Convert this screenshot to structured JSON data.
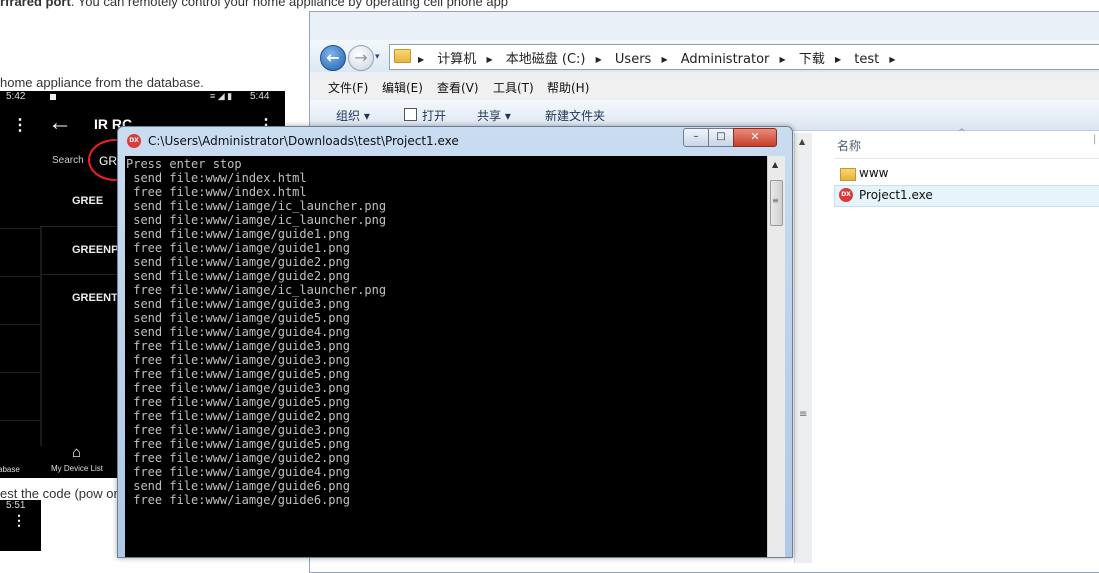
{
  "web": {
    "line1_bold": "rfrared port",
    "line1_rest": ". You can remotely control your home appliance by operating cell phone app",
    "line2": "home appliance from the database.",
    "line3": "est the code (pow on"
  },
  "phone": {
    "time_left": "5:42",
    "time_right": "5:44",
    "status_icons": "≡ ◢ ▮",
    "menu_icon": "⋮",
    "back_icon": "←",
    "title": "IR RC",
    "search_label": "Search",
    "search_value": "GR",
    "brands": [
      "GREE",
      "GREENP",
      "GREENT"
    ],
    "home_icon": "⌂",
    "device_list_label": "My Device List",
    "database_label": "abase"
  },
  "phone2": {
    "time": "5:51",
    "menu_icon": "⋮"
  },
  "explorer": {
    "breadcrumbs": [
      "计算机",
      "本地磁盘 (C:)",
      "Users",
      "Administrator",
      "下载",
      "test"
    ],
    "crumb_separator": "▶",
    "menu": [
      "文件(F)",
      "编辑(E)",
      "查看(V)",
      "工具(T)",
      "帮助(H)"
    ],
    "toolbar": {
      "organize": "组织 ▾",
      "open": "打开",
      "share": "共享 ▾",
      "new_folder": "新建文件夹"
    },
    "column_name": "名称",
    "files": [
      {
        "name": "www",
        "type": "folder"
      },
      {
        "name": "Project1.exe",
        "type": "exe",
        "selected": true
      }
    ],
    "back_icon": "←",
    "forward_icon": "→",
    "dropdown_icon": "▾"
  },
  "console": {
    "title": "C:\\Users\\Administrator\\Downloads\\test\\Project1.exe",
    "icon_text": "DX",
    "buttons": {
      "minimize": "–",
      "maximize": "□",
      "close": "✕"
    },
    "lines": [
      "Press enter stop",
      " send file:www/index.html",
      " free file:www/index.html",
      " send file:www/iamge/ic_launcher.png",
      " send file:www/iamge/ic_launcher.png",
      " send file:www/iamge/guide1.png",
      " free file:www/iamge/guide1.png",
      " send file:www/iamge/guide2.png",
      " send file:www/iamge/guide2.png",
      " free file:www/iamge/ic_launcher.png",
      " send file:www/iamge/guide3.png",
      " send file:www/iamge/guide5.png",
      " send file:www/iamge/guide4.png",
      " free file:www/iamge/guide3.png",
      " free file:www/iamge/guide3.png",
      " free file:www/iamge/guide5.png",
      " free file:www/iamge/guide3.png",
      " free file:www/iamge/guide5.png",
      " free file:www/iamge/guide2.png",
      " free file:www/iamge/guide3.png",
      " free file:www/iamge/guide5.png",
      " free file:www/iamge/guide2.png",
      " free file:www/iamge/guide4.png",
      " send file:www/iamge/guide6.png",
      " free file:www/iamge/guide6.png"
    ]
  },
  "colors": {
    "console_bg": "#000000",
    "console_text": "#c0c0c0",
    "close_button": "#c6402a",
    "phone_highlight": "#ee2222"
  }
}
